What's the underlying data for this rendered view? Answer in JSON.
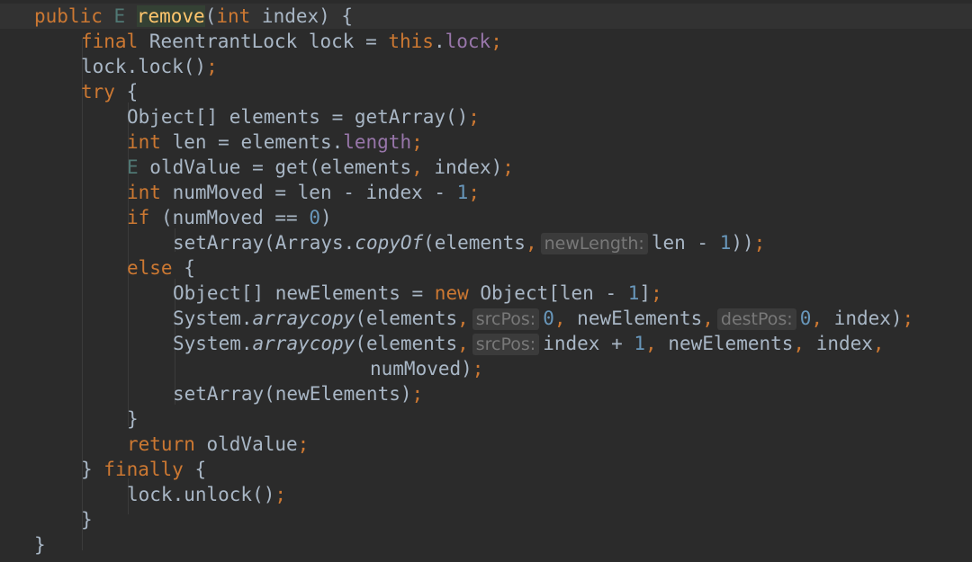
{
  "colors": {
    "background": "#2b2b2b",
    "default_text": "#a9b7c6",
    "keyword": "#cc7832",
    "number": "#6897bb",
    "field": "#9876aa",
    "method_declaration": "#ffc66d",
    "type_parameter": "#507874",
    "inlay_hint_bg": "#3b3b3b",
    "inlay_hint_text": "#787878"
  },
  "code": {
    "l1": {
      "kw_public": "public",
      "tp_E": "E",
      "method": "remove",
      "p_open": "(",
      "kw_int": "int",
      "rest": " index) {"
    },
    "l2": {
      "kw_final": "final",
      "mid": " ReentrantLock lock = ",
      "kw_this": "this",
      "dot": ".",
      "field_lock": "lock",
      "semi": ";"
    },
    "l3": {
      "text": "lock.lock()",
      "semi": ";"
    },
    "l4": {
      "kw_try": "try",
      "rest": " {"
    },
    "l5": {
      "text": "Object[] elements = getArray()",
      "semi": ";"
    },
    "l6": {
      "kw_int": "int",
      "mid": " len = elements.",
      "field_length": "length",
      "semi": ";"
    },
    "l7": {
      "tp_E": "E",
      "mid": " oldValue = get(elements",
      "comma": ",",
      "rest": " index)",
      "semi": ";"
    },
    "l8": {
      "kw_int": "int",
      "mid": " numMoved = len - index - ",
      "num": "1",
      "semi": ";"
    },
    "l9": {
      "kw_if": "if",
      "mid": " (numMoved == ",
      "num": "0",
      "rest": ")"
    },
    "l10": {
      "pre": "setArray(Arrays.",
      "call": "copyOf",
      "open": "(elements",
      "comma": ",",
      "hint": "newLength:",
      "post": "len - ",
      "num": "1",
      "close": "))",
      "semi": ";"
    },
    "l11": {
      "kw_else": "else",
      "rest": " {"
    },
    "l12": {
      "pre": "Object[] newElements = ",
      "kw_new": "new",
      "mid": " Object[len - ",
      "num": "1",
      "close": "]",
      "semi": ";"
    },
    "l13": {
      "pre": "System.",
      "call": "arraycopy",
      "open": "(elements",
      "c1": ",",
      "hint1": "srcPos:",
      "num1": "0",
      "c2": ",",
      "mid": " newElements",
      "c3": ",",
      "hint2": "destPos:",
      "num2": "0",
      "c4": ",",
      "rest": " index)",
      "semi": ";"
    },
    "l14": {
      "pre": "System.",
      "call": "arraycopy",
      "open": "(elements",
      "c1": ",",
      "hint1": "srcPos:",
      "mid": "index + ",
      "num": "1",
      "c2": ",",
      "mid2": " newElements",
      "c3": ",",
      "mid3": " index",
      "c4": ","
    },
    "l15": {
      "text": "numMoved)",
      "semi": ";"
    },
    "l16": {
      "text": "setArray(newElements)",
      "semi": ";"
    },
    "l17": {
      "text": "}"
    },
    "l18": {
      "kw_return": "return",
      "rest": " oldValue",
      "semi": ";"
    },
    "l19": {
      "pre": "} ",
      "kw_finally": "finally",
      "rest": " {"
    },
    "l20": {
      "text": "lock.unlock()",
      "semi": ";"
    },
    "l21": {
      "text": "}"
    },
    "l22": {
      "text": "}"
    }
  }
}
